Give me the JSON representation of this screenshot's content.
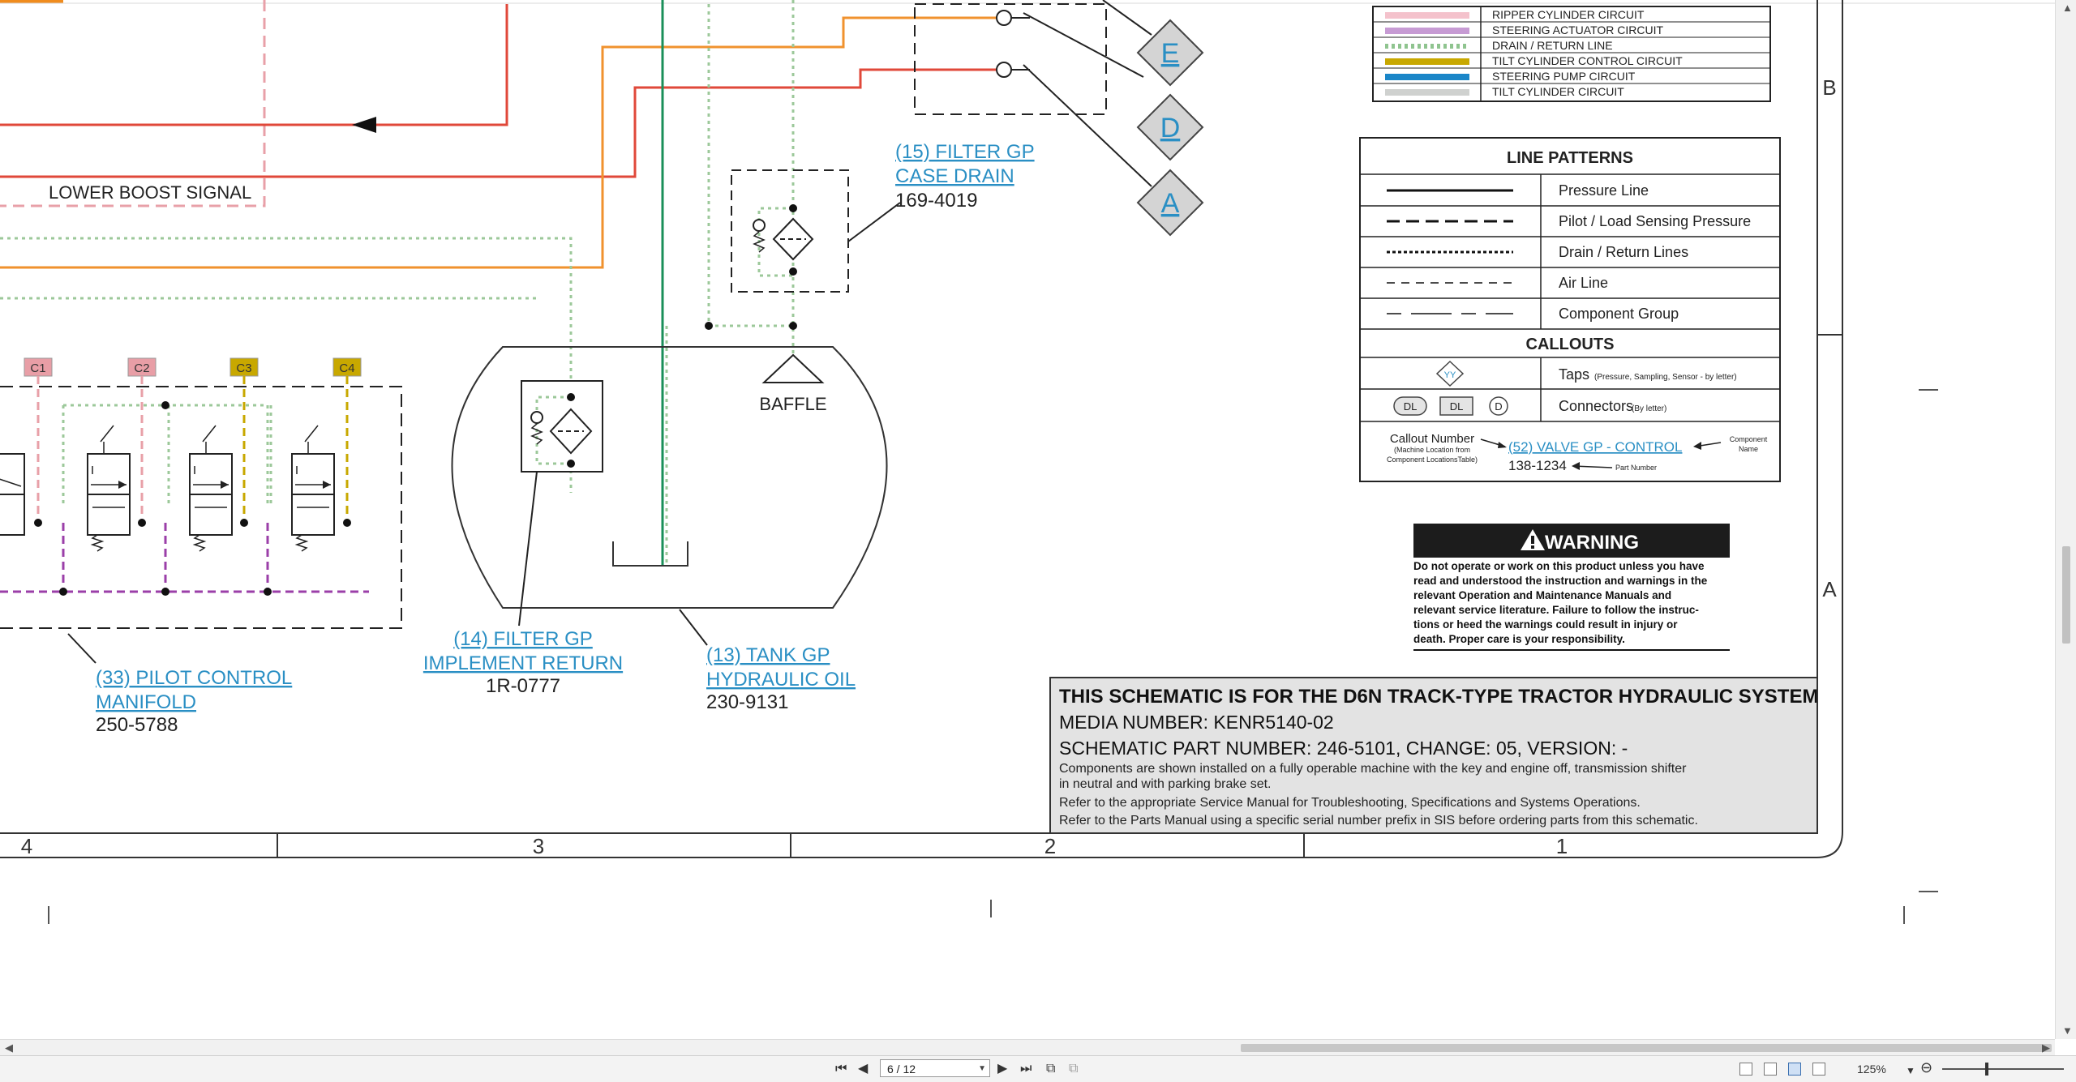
{
  "legend_colors": [
    {
      "label": "RIPPER CYLINDER CIRCUIT",
      "color": "#f4c2cc",
      "pattern": "solid"
    },
    {
      "label": "STEERING ACTUATOR CIRCUIT",
      "color": "#c79bd4",
      "pattern": "solid"
    },
    {
      "label": "DRAIN / RETURN LINE",
      "color": "#8fc48f",
      "pattern": "dotted"
    },
    {
      "label": "TILT CYLINDER CONTROL CIRCUIT",
      "color": "#c8a800",
      "pattern": "solid"
    },
    {
      "label": "STEERING PUMP CIRCUIT",
      "color": "#1a86c8",
      "pattern": "solid"
    },
    {
      "label": "TILT CYLINDER CIRCUIT",
      "color": "#cfd1cf",
      "pattern": "solid"
    }
  ],
  "line_patterns": {
    "title": "LINE PATTERNS",
    "items": [
      "Pressure Line",
      "Pilot / Load Sensing Pressure",
      "Drain / Return Lines",
      "Air Line",
      "Component Group"
    ]
  },
  "callouts": {
    "title": "CALLOUTS",
    "tap_symbol": "YY",
    "taps_label": "Taps",
    "taps_note": "(Pressure, Sampling, Sensor - by letter)",
    "connector_symbols": [
      "DL",
      "DL",
      "D"
    ],
    "connectors_label": "Connectors",
    "connectors_note": "(By letter)",
    "callout_number_label": "Callout Number",
    "callout_number_note_1": "(Machine Location from",
    "callout_number_note_2": "Component LocationsTable)",
    "example_callout": "(52) VALVE GP - CONTROL",
    "example_part": "138-1234",
    "component_name_1": "Component",
    "component_name_2": "Name",
    "part_number_label": "Part Number"
  },
  "warning": {
    "title": "WARNING",
    "lines": [
      "Do not operate or work on this product unless you have",
      "read and understood the instruction and warnings in the",
      "relevant Operation and Maintenance Manuals and",
      "relevant service literature. Failure to follow the instruc-",
      "tions or heed the warnings could result in injury or",
      "death. Proper care is your responsibility."
    ]
  },
  "title_block": {
    "title": "THIS SCHEMATIC IS FOR THE D6N TRACK-TYPE TRACTOR HYDRAULIC SYSTEM",
    "media": "MEDIA NUMBER: KENR5140-02",
    "part": "SCHEMATIC PART NUMBER: 246-5101, CHANGE: 05, VERSION: -",
    "notes": [
      "Components are shown installed on a fully operable machine with the key and engine off, transmission shifter",
      "in neutral and with parking brake set.",
      "Refer to the appropriate Service Manual for Troubleshooting, Specifications and Systems Operations.",
      "Refer to the Parts Manual using a specific serial number prefix in SIS before ordering parts from this schematic."
    ]
  },
  "components": {
    "filter_case_drain": {
      "name1": "(15) FILTER GP",
      "name2": "CASE DRAIN",
      "part": "169-4019"
    },
    "filter_implement_return": {
      "name1": "(14) FILTER GP",
      "name2": "IMPLEMENT RETURN",
      "part": "1R-0777"
    },
    "tank_hydraulic_oil": {
      "name1": "(13) TANK GP",
      "name2": "HYDRAULIC OIL",
      "part": "230-9131"
    },
    "pilot_control_manifold": {
      "name1": "(33) PILOT CONTROL",
      "name2": "MANIFOLD",
      "part": "250-5788"
    }
  },
  "labels": {
    "lower_boost_signal": "LOWER BOOST SIGNAL",
    "baffle": "BAFFLE"
  },
  "connectors": [
    "E",
    "D",
    "A"
  ],
  "ports": [
    "C1",
    "C2",
    "C3",
    "C4"
  ],
  "grid": {
    "columns": [
      "4",
      "3",
      "2",
      "1"
    ],
    "rows": [
      "B",
      "A"
    ]
  },
  "viewer": {
    "page_value": "6 / 12",
    "zoom": "125%"
  }
}
